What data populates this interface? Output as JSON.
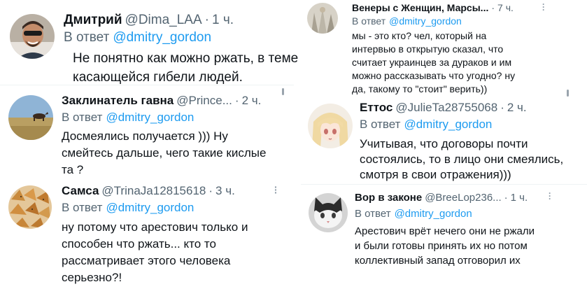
{
  "tweets": [
    {
      "name": "Дмитрий",
      "handle": "@Dima_LAA",
      "dot": "·",
      "time": "1 ч.",
      "reply_prefix": "В ответ",
      "mention": "@dmitry_gordon",
      "lines": [
        "Не понятно как можно ржать, в теме",
        "касающейся гибели людей."
      ]
    },
    {
      "name": "Заклинатель гавна",
      "handle": "@Prince...",
      "dot": "·",
      "time": "2 ч.",
      "reply_prefix": "В ответ",
      "mention": "@dmitry_gordon",
      "lines": [
        "Досмеялись получается ))) Ну",
        "смейтесь дальше, чего такие кислые",
        "та ?"
      ]
    },
    {
      "name": "Самса",
      "handle": "@TrinaJa12815618",
      "dot": "·",
      "time": "3 ч.",
      "reply_prefix": "В ответ",
      "mention": "@dmitry_gordon",
      "lines": [
        "ну потому что арестович только и",
        "способен что ржать... кто то",
        "рассматривает этого человека",
        "серьезно?!"
      ]
    },
    {
      "name": "Венеры с Женщин, Марсы...",
      "handle": "",
      "dot": "·",
      "time": "7 ч.",
      "reply_prefix": "В ответ",
      "mention": "@dmitry_gordon",
      "lines": [
        "мы - это кто? чел, который на",
        "интервью в открытую сказал, что",
        "считает украинцев за дураков и им",
        "можно рассказывать что угодно? ну",
        "да, такому то \"стоит\" верить))"
      ]
    },
    {
      "name": "Еттос",
      "handle": "@JulieTa28755068",
      "dot": "·",
      "time": "2 ч.",
      "reply_prefix": "В ответ",
      "mention": "@dmitry_gordon",
      "lines": [
        "Учитывая, что договоры почти",
        "состоялись, то в лицо они смеялись,",
        "смотря в свои отражения)))"
      ]
    },
    {
      "name": "Вор в законе",
      "handle": "@BreeLop236...",
      "dot": "·",
      "time": "1 ч.",
      "reply_prefix": "В ответ",
      "mention": "@dmitry_gordon",
      "lines": [
        "Арестович врёт нечего они не ржали",
        "и были готовы принять их но потом",
        "коллективный запад отговорил их"
      ]
    }
  ],
  "icons": {
    "more": "more-vertical-icon"
  },
  "colors": {
    "link": "#1d9bf0",
    "secondary": "#536471",
    "text": "#0f1419"
  }
}
